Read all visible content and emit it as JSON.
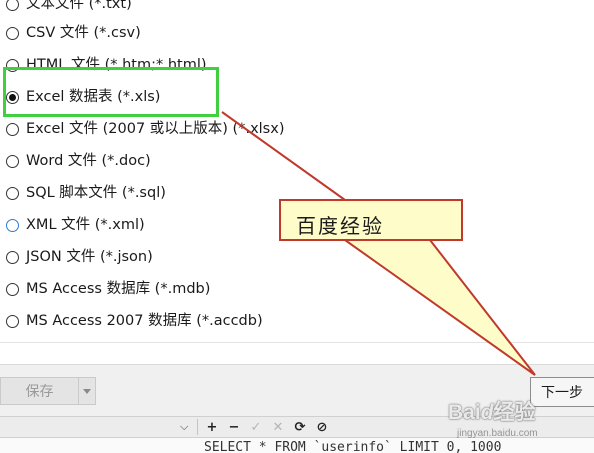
{
  "formats": [
    {
      "label": "文本文件 (*.txt)",
      "checked": false
    },
    {
      "label": "CSV 文件 (*.csv)",
      "checked": false
    },
    {
      "label": "HTML 文件 (*.htm;*.html)",
      "checked": false
    },
    {
      "label": "Excel 数据表 (*.xls)",
      "checked": true
    },
    {
      "label": "Excel 文件 (2007 或以上版本) (*.xlsx)",
      "checked": false
    },
    {
      "label": "Word 文件 (*.doc)",
      "checked": false
    },
    {
      "label": "SQL 脚本文件 (*.sql)",
      "checked": false
    },
    {
      "label": "XML 文件 (*.xml)",
      "checked": false
    },
    {
      "label": "JSON 文件 (*.json)",
      "checked": false
    },
    {
      "label": "MS Access 数据库 (*.mdb)",
      "checked": false
    },
    {
      "label": "MS Access 2007 数据库 (*.accdb)",
      "checked": false
    }
  ],
  "buttons": {
    "save": "保存",
    "next": "下一步"
  },
  "toolbar": {
    "icons": [
      "plus-icon",
      "minus-icon",
      "check-icon",
      "cross-icon",
      "refresh-icon",
      "stop-icon"
    ],
    "sql": "SELECT * FROM `userinfo` LIMIT 0, 1000"
  },
  "callout": {
    "text": "百度经验"
  },
  "watermark": {
    "brand": "Bai𝒹百经验",
    "url": "jingyan.baidu.com"
  },
  "colors": {
    "highlight": "#3fcf3f",
    "arrow_fill": "#fefcc8",
    "arrow_stroke": "#c0392b"
  }
}
